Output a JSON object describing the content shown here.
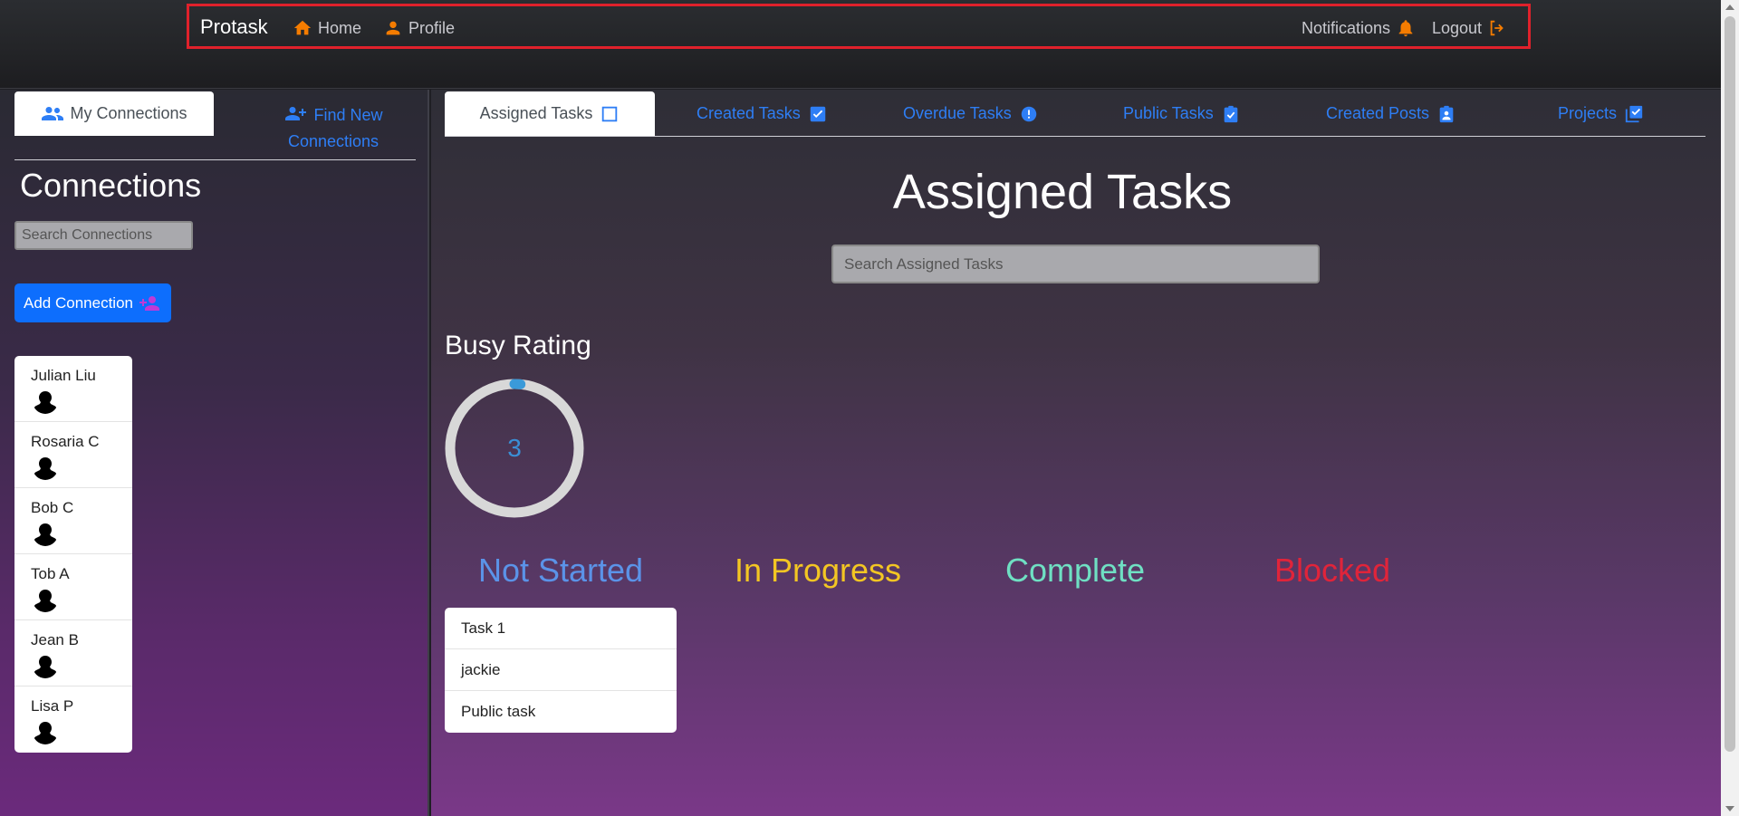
{
  "navbar": {
    "brand": "Protask",
    "home_label": "Home",
    "profile_label": "Profile",
    "notifications_label": "Notifications",
    "logout_label": "Logout",
    "accent_color": "#f57c00",
    "highlight_border_color": "#e0212b"
  },
  "left_panel": {
    "tabs": {
      "my_connections": "My Connections",
      "find_new_line1": "Find New",
      "find_new_line2": "Connections"
    },
    "title": "Connections",
    "search_placeholder": "Search Connections",
    "add_button_label": "Add Connection",
    "connections": [
      {
        "name": "Julian Liu"
      },
      {
        "name": "Rosaria C"
      },
      {
        "name": "Bob C"
      },
      {
        "name": "Tob A"
      },
      {
        "name": "Jean B"
      },
      {
        "name": "Lisa P"
      }
    ]
  },
  "main_panel": {
    "tabs": {
      "assigned": "Assigned Tasks",
      "created": "Created Tasks",
      "overdue": "Overdue Tasks",
      "public": "Public Tasks",
      "posts": "Created Posts",
      "projects": "Projects"
    },
    "title": "Assigned Tasks",
    "search_placeholder": "Search Assigned Tasks",
    "busy_rating_label": "Busy Rating",
    "busy_rating_value": "3",
    "busy_rating_fraction": 0.03,
    "status_columns": {
      "not_started": "Not Started",
      "in_progress": "In Progress",
      "complete": "Complete",
      "blocked": "Blocked"
    },
    "not_started_tasks": [
      {
        "title": "Task 1"
      },
      {
        "title": "jackie"
      },
      {
        "title": "Public task"
      }
    ]
  }
}
